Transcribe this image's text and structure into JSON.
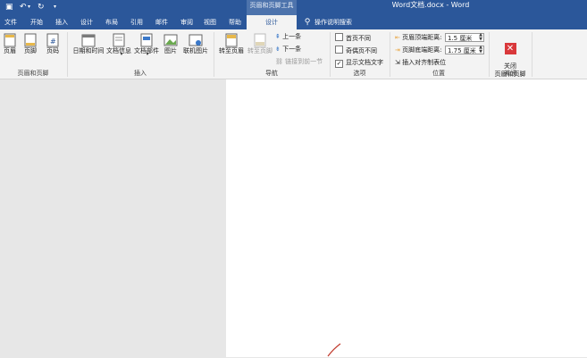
{
  "title_bar": {
    "contextual_tool": "页眉和页脚工具",
    "document_title": "Word文档.docx  -  Word"
  },
  "tabs": [
    "文件",
    "开始",
    "插入",
    "设计",
    "布局",
    "引用",
    "邮件",
    "审阅",
    "视图",
    "帮助"
  ],
  "active_tab": "设计",
  "tell_me": "操作说明搜索",
  "groups": {
    "header_footer": {
      "label": "页眉和页脚",
      "buttons": [
        "页眉",
        "页脚",
        "页码"
      ]
    },
    "insert": {
      "label": "插入",
      "buttons": [
        "日期和时间",
        "文档信息",
        "文档部件",
        "图片",
        "联机图片"
      ]
    },
    "navigation": {
      "label": "导航",
      "goto_header": "转至页眉",
      "goto_footer": "转至页脚",
      "previous": "上一条",
      "next": "下一条",
      "link_previous": "链接到前一节"
    },
    "options": {
      "label": "选项",
      "first_page": "首页不同",
      "odd_even": "奇偶页不同",
      "show_text": "显示文档文字",
      "show_text_checked": true
    },
    "position": {
      "label": "位置",
      "header_top_label": "页眉顶端距离:",
      "header_top_value": "1.5 厘米",
      "footer_bottom_label": "页脚底端距离:",
      "footer_bottom_value": "1.75 厘米",
      "align_tab": "插入对齐制表位"
    },
    "close": {
      "label": "关闭",
      "button": "关闭\n页眉和页脚"
    }
  },
  "colors": {
    "title_blue": "#2b579a",
    "ribbon_bg": "#f3f3f3",
    "close_red": "#d9383b"
  }
}
